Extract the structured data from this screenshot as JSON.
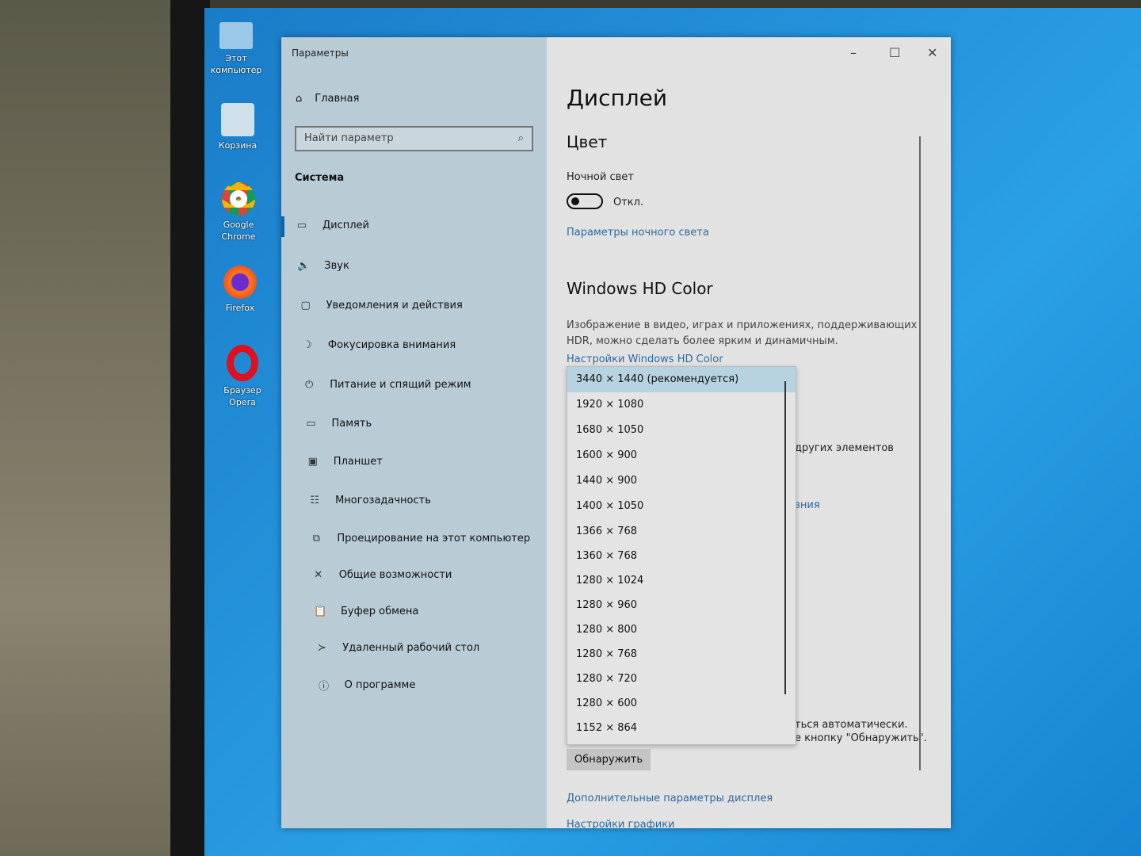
{
  "desktop": {
    "icons": [
      {
        "label": "Этот компьютер"
      },
      {
        "label": "Корзина"
      },
      {
        "label": "Google Chrome"
      },
      {
        "label": "Firefox"
      },
      {
        "label": "Браузер Opera"
      }
    ]
  },
  "window": {
    "title": "Параметры",
    "controls": {
      "minimize": "–",
      "maximize": "☐",
      "close": "✕"
    }
  },
  "sidebar": {
    "home": "Главная",
    "search_placeholder": "Найти параметр",
    "section": "Система",
    "items": [
      {
        "label": "Дисплей",
        "icon": "▭"
      },
      {
        "label": "Звук",
        "icon": "🔈"
      },
      {
        "label": "Уведомления и действия",
        "icon": "▢"
      },
      {
        "label": "Фокусировка внимания",
        "icon": "☽"
      },
      {
        "label": "Питание и спящий режим",
        "icon": "⏻"
      },
      {
        "label": "Память",
        "icon": "▭"
      },
      {
        "label": "Планшет",
        "icon": "▣"
      },
      {
        "label": "Многозадачность",
        "icon": "☷"
      },
      {
        "label": "Проецирование на этот компьютер",
        "icon": "⧉"
      },
      {
        "label": "Общие возможности",
        "icon": "✕"
      },
      {
        "label": "Буфер обмена",
        "icon": "📋"
      },
      {
        "label": "Удаленный рабочий стол",
        "icon": "≻"
      },
      {
        "label": "О программе",
        "icon": "ⓘ"
      }
    ]
  },
  "main": {
    "title": "Дисплей",
    "color_heading": "Цвет",
    "night_light_label": "Ночной свет",
    "night_light_state": "Откл.",
    "night_light_on": false,
    "night_light_link": "Параметры ночного света",
    "hd_heading": "Windows HD Color",
    "hd_text_1": "Изображение в видео, играх и приложениях, поддерживающих",
    "hd_text_2": "HDR, можно сделать более ярким и динамичным.",
    "hd_link": "Настройки Windows HD Color",
    "partial_1": "других элементов",
    "partial_2": "зния",
    "partial_3": "ться автоматически.",
    "partial_4": "е кнопку \"Обнаружить\".",
    "detect_button": "Обнаружить",
    "advanced_link": "Дополнительные параметры дисплея",
    "graphics_link": "Настройки графики"
  },
  "resolution_dropdown": {
    "selected": "3440 × 1440 (рекомендуется)",
    "options": [
      "3440 × 1440 (рекомендуется)",
      "1920 × 1080",
      "1680 × 1050",
      "1600 × 900",
      "1440 × 900",
      "1400 × 1050",
      "1366 × 768",
      "1360 × 768",
      "1280 × 1024",
      "1280 × 960",
      "1280 × 800",
      "1280 × 768",
      "1280 × 720",
      "1280 × 600",
      "1152 × 864"
    ]
  }
}
